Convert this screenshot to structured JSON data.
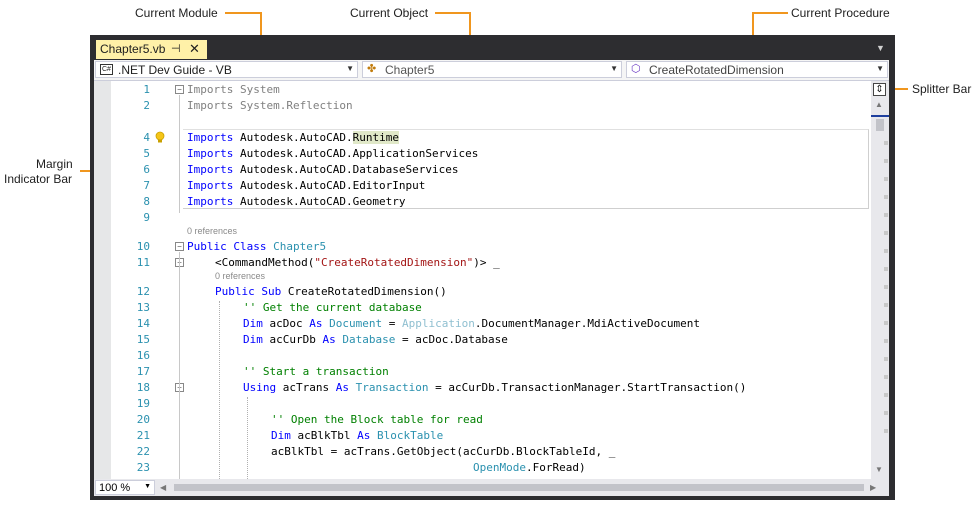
{
  "callouts": {
    "current_module": "Current Module",
    "current_object": "Current Object",
    "current_procedure": "Current Procedure",
    "splitter_bar": "Splitter Bar",
    "margin_indicator_line1": "Margin",
    "margin_indicator_line2": "Indicator Bar"
  },
  "tab": {
    "name": "Chapter5.vb",
    "pin": "⊣",
    "close": "✕"
  },
  "navbar": {
    "module": "🄲 .NET Dev Guide - VB",
    "module_label": ".NET Dev Guide - VB",
    "object_label": "Chapter5",
    "procedure_label": "CreateRotatedDimension"
  },
  "refs": "0 references",
  "zoom": "100 %",
  "colors": {
    "accent": "#f0961e",
    "keyword": "#0000ff",
    "type": "#2b91af",
    "comment": "#008000",
    "string": "#a31515",
    "tab_active": "#fff1a8"
  },
  "code": {
    "l1": [
      "Imports",
      " System"
    ],
    "l2": [
      "Imports",
      " System.Reflection"
    ],
    "l4": [
      "Imports",
      " Autodesk.AutoCAD.",
      "Runtime"
    ],
    "l5": [
      "Imports",
      " Autodesk.AutoCAD.ApplicationServices"
    ],
    "l6": [
      "Imports",
      " Autodesk.AutoCAD.DatabaseServices"
    ],
    "l7": [
      "Imports",
      " Autodesk.AutoCAD.EditorInput"
    ],
    "l8": [
      "Imports",
      " Autodesk.AutoCAD.Geometry"
    ],
    "l10": [
      "Public Class",
      " ",
      "Chapter5"
    ],
    "l11": [
      "<CommandMethod(",
      "\"CreateRotatedDimension\"",
      ")> _"
    ],
    "l12": [
      "Public Sub",
      " CreateRotatedDimension()"
    ],
    "l13": "'' Get the current database",
    "l14": [
      "Dim",
      " acDoc ",
      "As",
      " ",
      "Document",
      " = ",
      "Application",
      ".DocumentManager.MdiActiveDocument"
    ],
    "l15": [
      "Dim",
      " acCurDb ",
      "As",
      " ",
      "Database",
      " = acDoc.Database"
    ],
    "l17": "'' Start a transaction",
    "l18": [
      "Using",
      " acTrans ",
      "As",
      " ",
      "Transaction",
      " = acCurDb.TransactionManager.StartTransaction()"
    ],
    "l20": "'' Open the Block table for read",
    "l21": [
      "Dim",
      " acBlkTbl ",
      "As",
      " ",
      "BlockTable"
    ],
    "l22": "acBlkTbl = acTrans.GetObject(acCurDb.BlockTableId, _",
    "l23": [
      "OpenMode",
      ".ForRead)"
    ]
  },
  "line_numbers": [
    "1",
    "2",
    "",
    "4",
    "5",
    "6",
    "7",
    "8",
    "9",
    "10",
    "11",
    "12",
    "13",
    "14",
    "15",
    "16",
    "17",
    "18",
    "19",
    "20",
    "21",
    "22",
    "23"
  ]
}
